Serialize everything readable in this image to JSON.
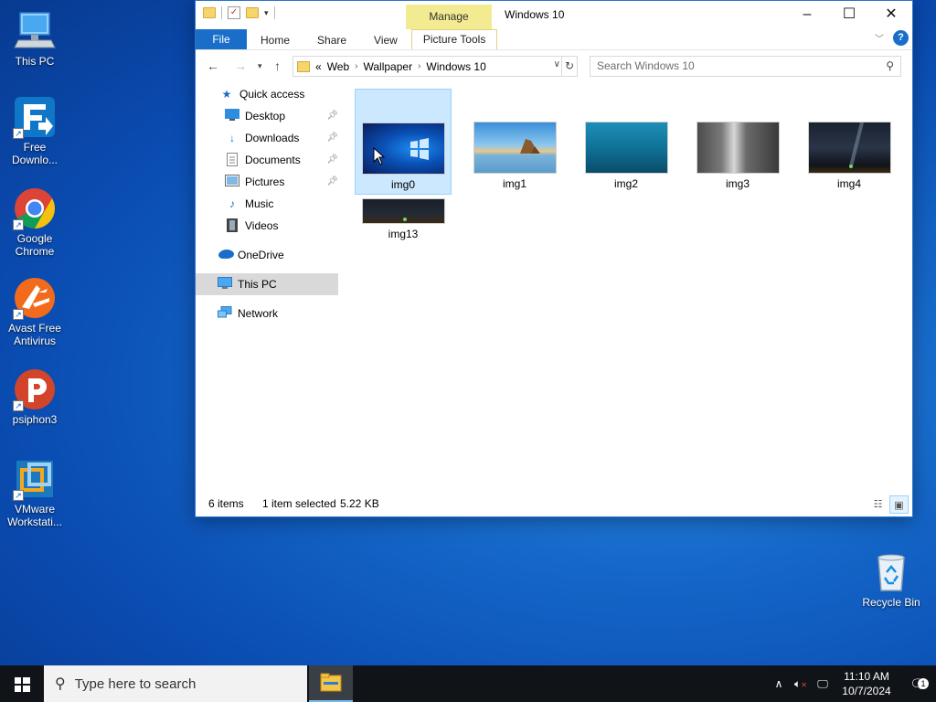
{
  "desktop": {
    "icons": [
      {
        "label": "This PC"
      },
      {
        "label": "Free Downlo..."
      },
      {
        "label": "Google Chrome"
      },
      {
        "label": "Avast Free Antivirus"
      },
      {
        "label": "psiphon3"
      },
      {
        "label": "VMware Workstati..."
      }
    ],
    "recycle_bin": {
      "label": "Recycle Bin"
    }
  },
  "explorer": {
    "title": "Windows 10",
    "manage_tab": "Manage",
    "ribbon": {
      "file": "File",
      "home": "Home",
      "share": "Share",
      "view": "View",
      "picture_tools": "Picture Tools",
      "help": "?"
    },
    "address": {
      "overflow": "«",
      "crumbs": [
        "Web",
        "Wallpaper",
        "Windows 10"
      ]
    },
    "search": {
      "placeholder": "Search Windows 10"
    },
    "nav": {
      "quick_access": "Quick access",
      "desktop": "Desktop",
      "downloads": "Downloads",
      "documents": "Documents",
      "pictures": "Pictures",
      "music": "Music",
      "videos": "Videos",
      "onedrive": "OneDrive",
      "this_pc": "This PC",
      "network": "Network"
    },
    "files": [
      {
        "name": "img0",
        "selected": true
      },
      {
        "name": "img1"
      },
      {
        "name": "img2"
      },
      {
        "name": "img3"
      },
      {
        "name": "img4"
      },
      {
        "name": "img13"
      }
    ],
    "status": {
      "count": "6 items",
      "selection": "1 item selected",
      "size": "5.22 KB"
    }
  },
  "taskbar": {
    "search_placeholder": "Type here to search",
    "time": "11:10 AM",
    "date": "10/7/2024",
    "notification_count": "1"
  }
}
